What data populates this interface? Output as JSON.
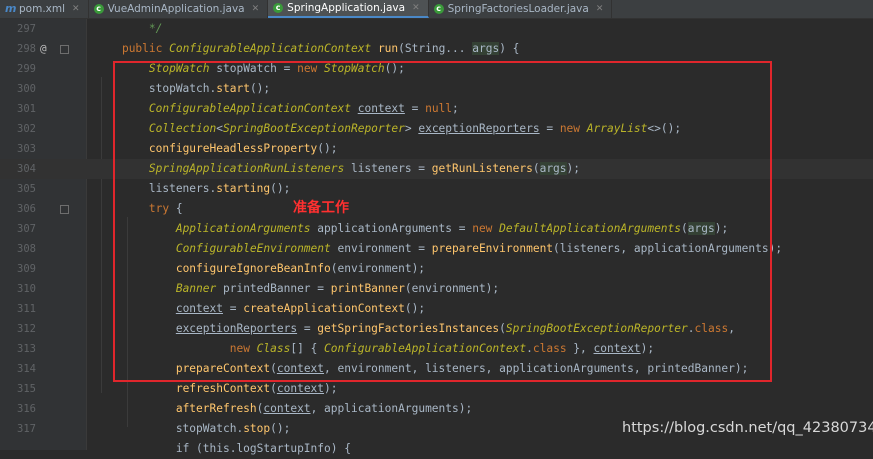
{
  "tabs": [
    {
      "label": "pom.xml",
      "icon": "m",
      "active": false
    },
    {
      "label": "VueAdminApplication.java",
      "icon": "c",
      "active": false
    },
    {
      "label": "SpringApplication.java",
      "icon": "c",
      "active": true
    },
    {
      "label": "SpringFactoriesLoader.java",
      "icon": "c",
      "active": false
    }
  ],
  "annotation": "准备工作",
  "watermark": "https://blog.csdn.net/qq_42380734",
  "colors": {
    "keyword": "#cc7832",
    "type": "#bbb529",
    "method": "#ffc66d",
    "field": "#9876aa",
    "comment": "#629755",
    "text": "#a9b7c6",
    "highlight_box": "#e0262c"
  },
  "lines": [
    {
      "num": "297",
      "tokens": [
        [
          "        */",
          "comment"
        ]
      ]
    },
    {
      "num": "298",
      "mark": "@",
      "fold": true,
      "tokens": [
        [
          "    ",
          "plain"
        ],
        [
          "public ",
          "kw"
        ],
        [
          "ConfigurableApplicationContext",
          "type"
        ],
        [
          " ",
          "plain"
        ],
        [
          "run",
          "method"
        ],
        [
          "(String... ",
          "plain"
        ],
        [
          "args",
          "param"
        ],
        [
          ") {",
          "plain"
        ]
      ]
    },
    {
      "num": "299",
      "tokens": [
        [
          "        ",
          "plain"
        ],
        [
          "StopWatch",
          "type"
        ],
        [
          " stopWatch = ",
          "plain"
        ],
        [
          "new ",
          "kw"
        ],
        [
          "StopWatch",
          "type"
        ],
        [
          "();",
          "plain"
        ]
      ]
    },
    {
      "num": "300",
      "tokens": [
        [
          "        stopWatch.",
          "plain"
        ],
        [
          "start",
          "method"
        ],
        [
          "();",
          "plain"
        ]
      ]
    },
    {
      "num": "301",
      "tokens": [
        [
          "        ",
          "plain"
        ],
        [
          "ConfigurableApplicationContext",
          "type"
        ],
        [
          " ",
          "plain"
        ],
        [
          "context",
          "ul"
        ],
        [
          " = ",
          "plain"
        ],
        [
          "null",
          "kw"
        ],
        [
          ";",
          "plain"
        ]
      ]
    },
    {
      "num": "302",
      "tokens": [
        [
          "        ",
          "plain"
        ],
        [
          "Collection",
          "type"
        ],
        [
          "<",
          "plain"
        ],
        [
          "SpringBootExceptionReporter",
          "type"
        ],
        [
          "> ",
          "plain"
        ],
        [
          "exceptionReporters",
          "ul"
        ],
        [
          " = ",
          "plain"
        ],
        [
          "new ",
          "kw"
        ],
        [
          "ArrayList",
          "type"
        ],
        [
          "<>();",
          "plain"
        ]
      ]
    },
    {
      "num": "303",
      "tokens": [
        [
          "        ",
          "plain"
        ],
        [
          "configureHeadlessProperty",
          "method"
        ],
        [
          "();",
          "plain"
        ]
      ]
    },
    {
      "num": "304",
      "current": true,
      "tokens": [
        [
          "        ",
          "plain"
        ],
        [
          "SpringApplicationRunListeners",
          "type"
        ],
        [
          " listeners = ",
          "plain"
        ],
        [
          "getRunListeners",
          "method"
        ],
        [
          "(",
          "plain"
        ],
        [
          "args",
          "param"
        ],
        [
          ");",
          "plain"
        ]
      ]
    },
    {
      "num": "305",
      "tokens": [
        [
          "        listeners.",
          "plain"
        ],
        [
          "starting",
          "method"
        ],
        [
          "();",
          "plain"
        ]
      ]
    },
    {
      "num": "306",
      "fold": true,
      "tokens": [
        [
          "        ",
          "plain"
        ],
        [
          "try",
          "kw"
        ],
        [
          " {",
          "plain"
        ]
      ]
    },
    {
      "num": "307",
      "tokens": [
        [
          "            ",
          "plain"
        ],
        [
          "ApplicationArguments",
          "type"
        ],
        [
          " applicationArguments = ",
          "plain"
        ],
        [
          "new ",
          "kw"
        ],
        [
          "DefaultApplicationArguments",
          "type"
        ],
        [
          "(",
          "plain"
        ],
        [
          "args",
          "param"
        ],
        [
          ");",
          "plain"
        ]
      ]
    },
    {
      "num": "308",
      "tokens": [
        [
          "            ",
          "plain"
        ],
        [
          "ConfigurableEnvironment",
          "type"
        ],
        [
          " environment = ",
          "plain"
        ],
        [
          "prepareEnvironment",
          "method"
        ],
        [
          "(listeners, applicationArguments);",
          "plain"
        ]
      ]
    },
    {
      "num": "309",
      "tokens": [
        [
          "            ",
          "plain"
        ],
        [
          "configureIgnoreBeanInfo",
          "method"
        ],
        [
          "(environment);",
          "plain"
        ]
      ]
    },
    {
      "num": "310",
      "tokens": [
        [
          "            ",
          "plain"
        ],
        [
          "Banner",
          "type"
        ],
        [
          " printedBanner = ",
          "plain"
        ],
        [
          "printBanner",
          "method"
        ],
        [
          "(environment);",
          "plain"
        ]
      ]
    },
    {
      "num": "311",
      "tokens": [
        [
          "            ",
          "plain"
        ],
        [
          "context",
          "ul"
        ],
        [
          " = ",
          "plain"
        ],
        [
          "createApplicationContext",
          "method"
        ],
        [
          "();",
          "plain"
        ]
      ]
    },
    {
      "num": "312",
      "tokens": [
        [
          "            ",
          "plain"
        ],
        [
          "exceptionReporters",
          "ul"
        ],
        [
          " = ",
          "plain"
        ],
        [
          "getSpringFactoriesInstances",
          "method"
        ],
        [
          "(",
          "plain"
        ],
        [
          "SpringBootExceptionReporter",
          "type"
        ],
        [
          ".",
          "plain"
        ],
        [
          "class",
          "kw"
        ],
        [
          ",",
          "plain"
        ]
      ]
    },
    {
      "num": "313",
      "tokens": [
        [
          "                    ",
          "plain"
        ],
        [
          "new ",
          "kw"
        ],
        [
          "Class",
          "type"
        ],
        [
          "[] { ",
          "plain"
        ],
        [
          "ConfigurableApplicationContext",
          "type"
        ],
        [
          ".",
          "plain"
        ],
        [
          "class",
          "kw"
        ],
        [
          " }, ",
          "plain"
        ],
        [
          "context",
          "ul"
        ],
        [
          ");",
          "plain"
        ]
      ]
    },
    {
      "num": "314",
      "tokens": [
        [
          "            ",
          "plain"
        ],
        [
          "prepareContext",
          "method"
        ],
        [
          "(",
          "plain"
        ],
        [
          "context",
          "ul"
        ],
        [
          ", environment, listeners, applicationArguments, printedBanner);",
          "plain"
        ]
      ]
    },
    {
      "num": "315",
      "tokens": [
        [
          "            ",
          "plain"
        ],
        [
          "refreshContext",
          "method"
        ],
        [
          "(",
          "plain"
        ],
        [
          "context",
          "ul"
        ],
        [
          ");",
          "plain"
        ]
      ]
    },
    {
      "num": "316",
      "tokens": [
        [
          "            ",
          "plain"
        ],
        [
          "afterRefresh",
          "method"
        ],
        [
          "(",
          "plain"
        ],
        [
          "context",
          "ul"
        ],
        [
          ", applicationArguments);",
          "plain"
        ]
      ]
    },
    {
      "num": "317",
      "tokens": [
        [
          "            stopWatch.",
          "plain"
        ],
        [
          "stop",
          "method"
        ],
        [
          "();",
          "plain"
        ]
      ]
    },
    {
      "num": "",
      "tokens": [
        [
          "            ",
          "plain"
        ],
        [
          "if (this.logStartupInfo) {",
          "plain"
        ]
      ]
    }
  ]
}
